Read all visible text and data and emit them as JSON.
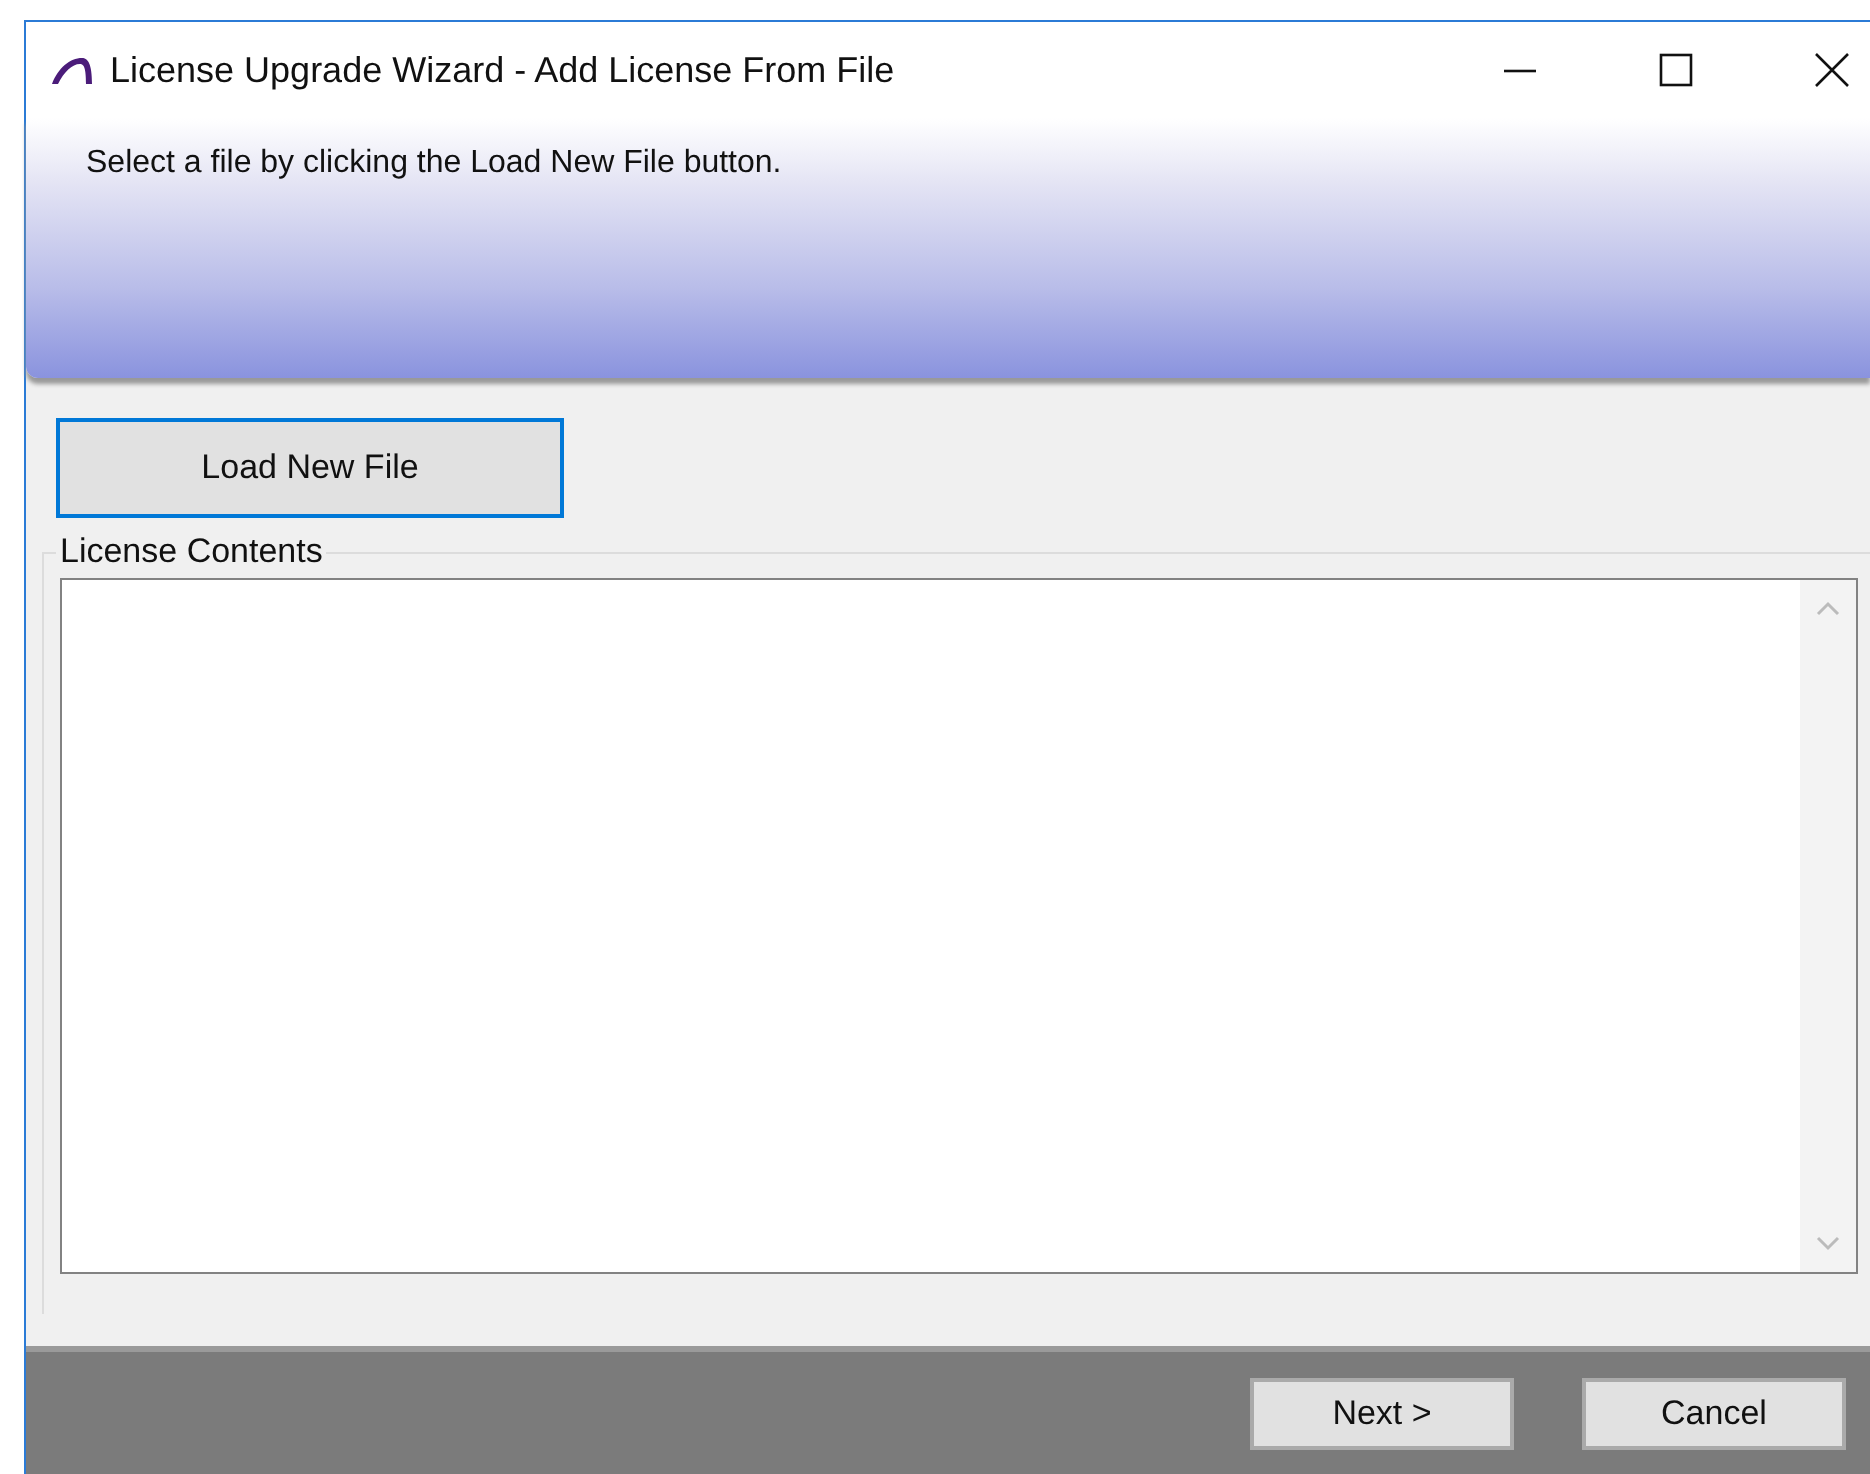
{
  "window": {
    "title": "License Upgrade Wizard - Add License From File"
  },
  "header": {
    "instruction": "Select a file by clicking the Load New File button."
  },
  "load_button": {
    "label": "Load New File",
    "focused": true
  },
  "license_group": {
    "label": "License Contents"
  },
  "buttons": [
    {
      "label": "Next >"
    },
    {
      "label": "Cancel"
    }
  ]
}
